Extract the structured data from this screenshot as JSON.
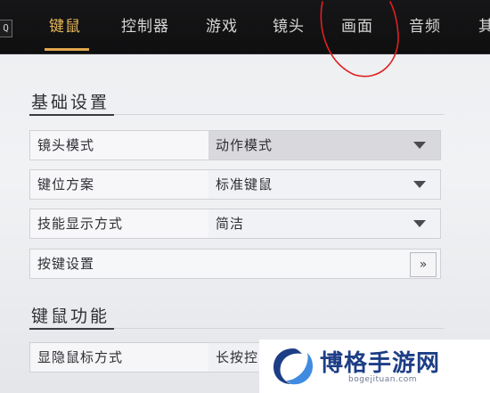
{
  "topbar": {
    "q_key": "Q",
    "tabs": [
      {
        "label": "键鼠",
        "active": true
      },
      {
        "label": "控制器",
        "active": false
      },
      {
        "label": "游戏",
        "active": false
      },
      {
        "label": "镜头",
        "active": false
      },
      {
        "label": "画面",
        "active": false
      },
      {
        "label": "音频",
        "active": false
      },
      {
        "label": "其",
        "active": false
      }
    ]
  },
  "sections": [
    {
      "title": "基础设置",
      "rows": [
        {
          "label": "镜头模式",
          "value": "动作模式",
          "control": "dropdown",
          "highlighted": true
        },
        {
          "label": "键位方案",
          "value": "标准键鼠",
          "control": "dropdown",
          "highlighted": false
        },
        {
          "label": "技能显示方式",
          "value": "简洁",
          "control": "dropdown",
          "highlighted": false
        },
        {
          "label": "按键设置",
          "value": "",
          "control": "button",
          "button_label": "»"
        }
      ]
    },
    {
      "title": "键鼠功能",
      "rows": [
        {
          "label": "显隐鼠标方式",
          "value": "长按控",
          "control": "dropdown",
          "highlighted": false
        }
      ]
    }
  ],
  "watermark": {
    "title": "博格手游网",
    "url": "bogejituan.com"
  },
  "colors": {
    "accent": "#e0a74e",
    "annotation": "#e02020",
    "watermark_blue": "#1d3e86"
  }
}
